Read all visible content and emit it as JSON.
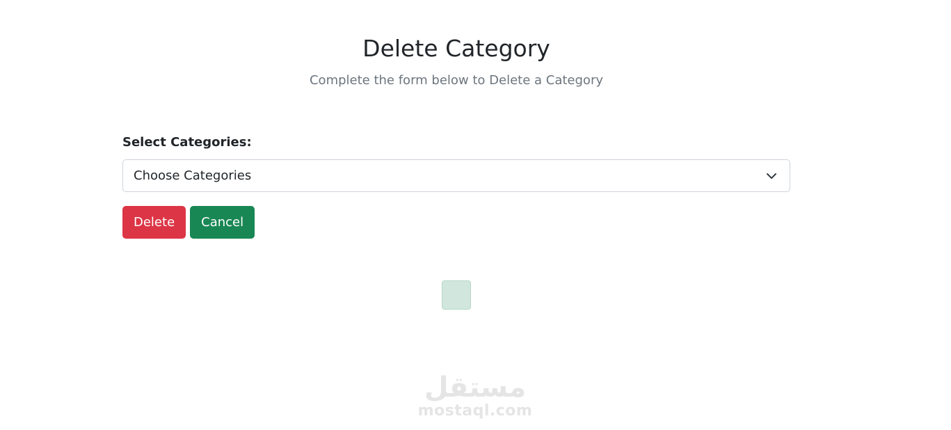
{
  "header": {
    "title": "Delete Category",
    "subtitle": "Complete the form below to Delete a Category"
  },
  "form": {
    "category_label": "Select Categories:",
    "category_select": {
      "selected": "Choose Categories"
    },
    "delete_label": "Delete",
    "cancel_label": "Cancel"
  },
  "colors": {
    "danger": "#dc3545",
    "success": "#198754",
    "muted_text": "#6c757d",
    "loader_bg": "#d1e7dd"
  },
  "icons": {
    "select_arrow": "chevron-down-icon"
  },
  "watermark": {
    "text": "mostaql.com",
    "logo": "مستقل"
  }
}
